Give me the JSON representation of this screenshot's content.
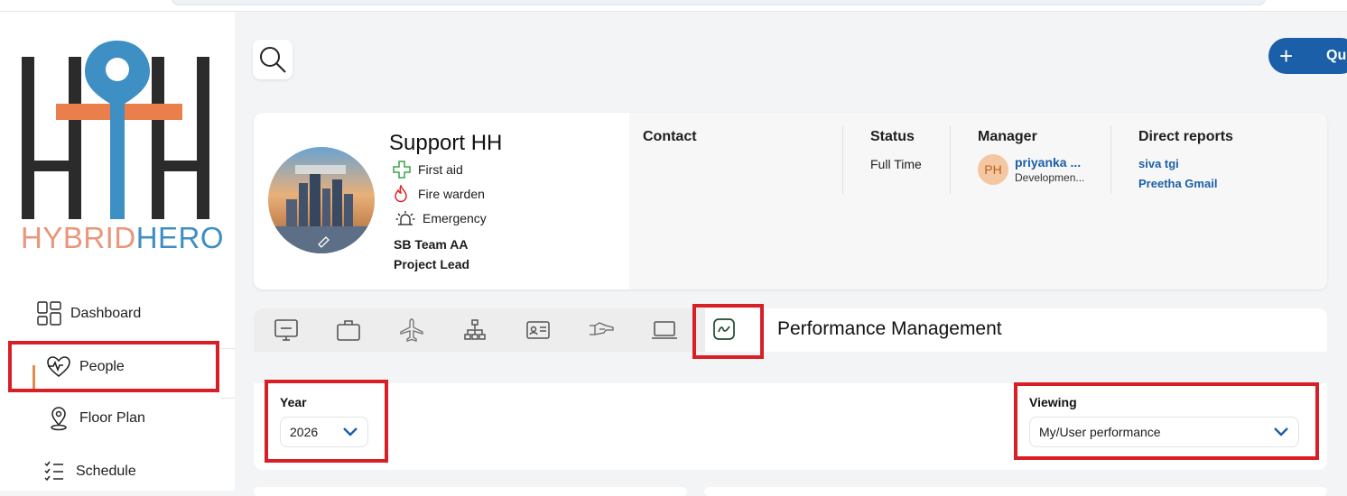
{
  "brand": {
    "logo_text_a": "HYBRID",
    "logo_text_b": "HERO"
  },
  "nav": {
    "items": [
      {
        "label": "Dashboard",
        "icon": "dashboard-grid-icon"
      },
      {
        "label": "People",
        "icon": "heart-pulse-icon",
        "active": true
      },
      {
        "label": "Floor Plan",
        "icon": "map-pin-icon"
      },
      {
        "label": "Schedule",
        "icon": "checklist-icon"
      }
    ]
  },
  "header": {
    "quick_label": "Qu"
  },
  "profile": {
    "name": "Support HH",
    "tags": [
      "First aid",
      "Fire warden",
      "Emergency"
    ],
    "team": "SB Team AA",
    "role": "Project Lead",
    "contact_label": "Contact",
    "status_label": "Status",
    "status_value": "Full Time",
    "manager_label": "Manager",
    "manager_initials": "PH",
    "manager_name": "priyanka ...",
    "manager_dept": "Developmen...",
    "reports_label": "Direct reports",
    "reports": [
      "siva tgi",
      "Preetha Gmail"
    ]
  },
  "tabs": {
    "icons": [
      "monitor-icon",
      "briefcase-icon",
      "airplane-icon",
      "org-chart-icon",
      "id-card-icon",
      "handshake-icon",
      "laptop-icon",
      "performance-chart-icon"
    ],
    "active_title": "Performance Management"
  },
  "filters": {
    "year_label": "Year",
    "year_value": "2026",
    "viewing_label": "Viewing",
    "viewing_value": "My/User performance"
  },
  "colors": {
    "accent": "#1b5fa8",
    "highlight": "#d91f26",
    "active_marker": "#e08c4e"
  }
}
